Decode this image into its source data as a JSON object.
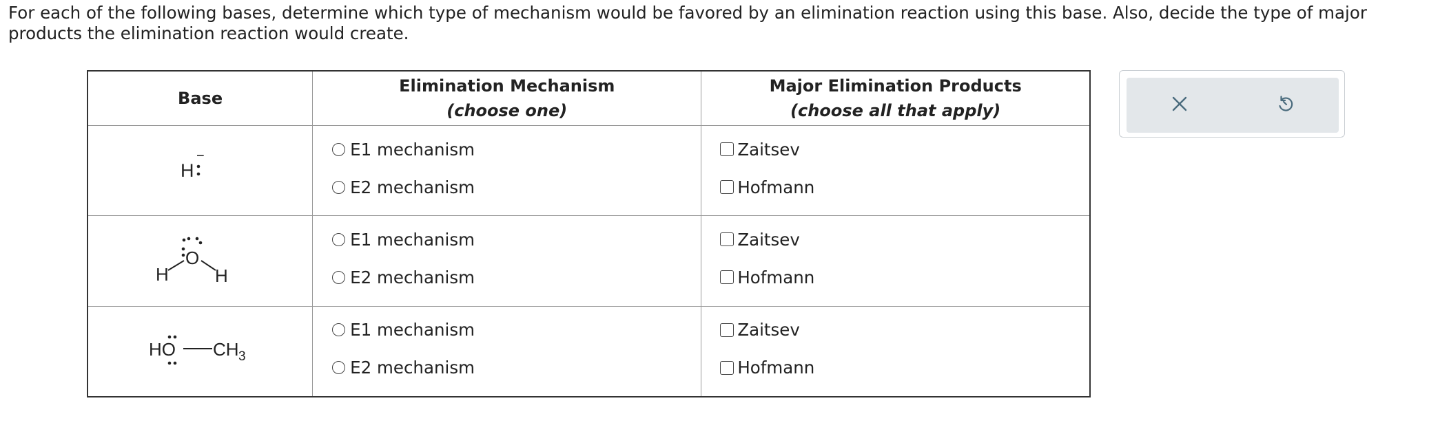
{
  "question": "For each of the following bases, determine which type of mechanism would be favored by an elimination reaction using this base. Also, decide the type of major products the elimination reaction would create.",
  "table": {
    "headers": {
      "base": "Base",
      "mechanism": "Elimination Mechanism",
      "mechanism_sub": "(choose one)",
      "products": "Major Elimination Products",
      "products_sub": "(choose all that apply)"
    },
    "rows": [
      {
        "base": {
          "atom": "H",
          "charge": "−",
          "label": "hydride"
        },
        "mechanism_options": [
          "E1 mechanism",
          "E2 mechanism"
        ],
        "product_options": [
          "Zaitsev",
          "Hofmann"
        ]
      },
      {
        "base": {
          "left": "H",
          "center": "O",
          "right": "H",
          "label": "water"
        },
        "mechanism_options": [
          "E1 mechanism",
          "E2 mechanism"
        ],
        "product_options": [
          "Zaitsev",
          "Hofmann"
        ]
      },
      {
        "base": {
          "left": "HO",
          "right": "CH",
          "subscript": "3",
          "label": "methanol"
        },
        "mechanism_options": [
          "E1 mechanism",
          "E2 mechanism"
        ],
        "product_options": [
          "Zaitsev",
          "Hofmann"
        ]
      }
    ]
  },
  "tools": {
    "clear_icon": "close-icon",
    "undo_icon": "undo-icon"
  },
  "colors": {
    "tool_icon": "#4a6b7d",
    "tool_bg": "#e3e7ea"
  }
}
